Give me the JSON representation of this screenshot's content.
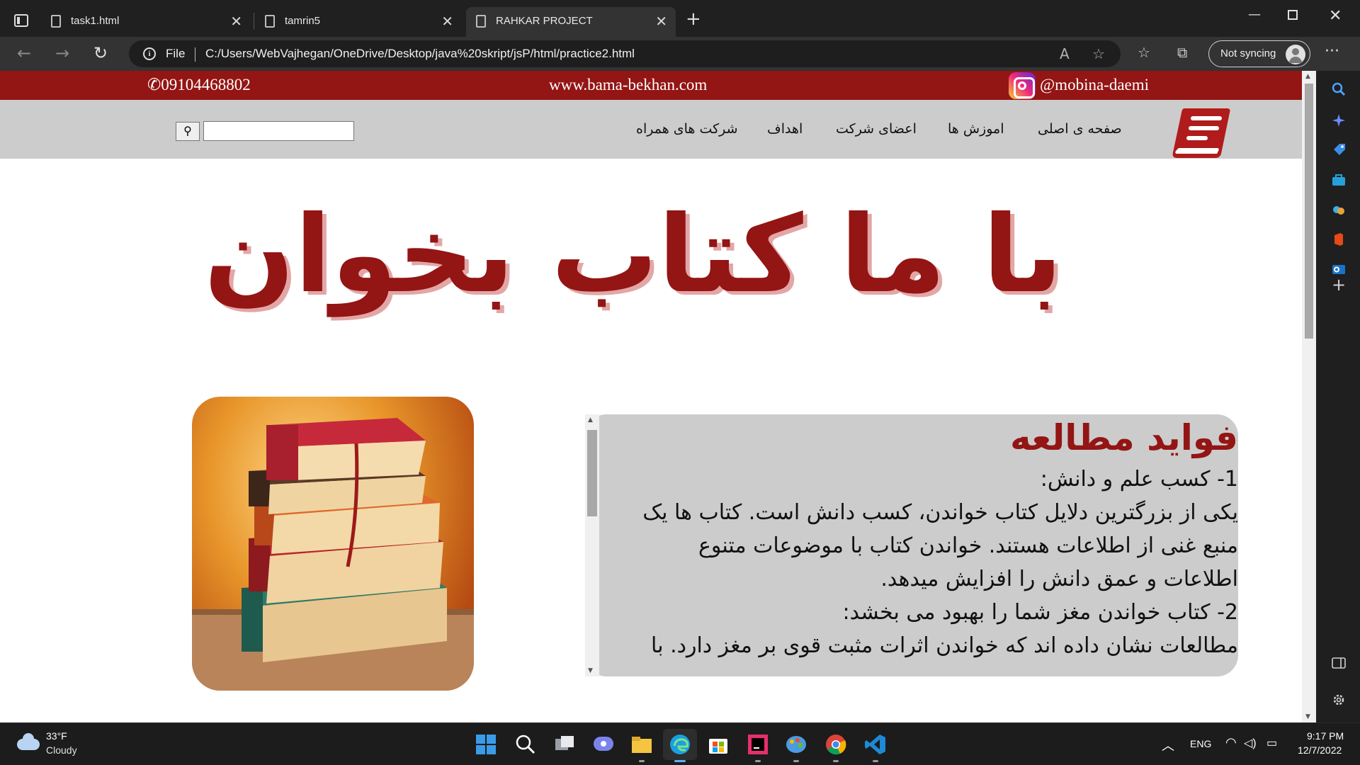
{
  "browser": {
    "tabs": [
      {
        "title": "task1.html"
      },
      {
        "title": "tamrin5"
      },
      {
        "title": "RAHKAR PROJECT"
      }
    ],
    "address": {
      "scheme": "File",
      "url": "C:/Users/WebVajhegan/OneDrive/Desktop/java%20skript/jsP/html/practice2.html"
    },
    "profile_label": "Not syncing"
  },
  "site": {
    "topbar": {
      "phone": "09104468802",
      "website": "www.bama-bekhan.com",
      "instagram": "@mobina-daemi"
    },
    "menu": [
      {
        "label": "صفحه ی اصلی"
      },
      {
        "label": "اموزش ها"
      },
      {
        "label": "اعضای شرکت"
      },
      {
        "label": "اهداف"
      },
      {
        "label": "شرکت های همراه"
      }
    ],
    "search": {
      "placeholder": ""
    },
    "hero_title": "با ما کتاب بخوان",
    "panel": {
      "title": "فواید مطالعه",
      "lines": [
        "1- کسب علم و دانش:",
        "یکی از بزرگترین دلایل کتاب خواندن، کسب دانش است. کتاب ها یک",
        "منبع غنی از اطلاعات هستند. خواندن کتاب با موضوعات متنوع",
        "اطلاعات و عمق دانش را افزایش میدهد.",
        "2- کتاب خواندن مغز شما را بهبود می بخشد:",
        "مطالعات نشان داده اند که خواندن اثرات مثبت قوی بر مغز دارد. با"
      ]
    }
  },
  "taskbar": {
    "weather": {
      "temp": "33°F",
      "desc": "Cloudy"
    },
    "lang": "ENG",
    "time": "9:17 PM",
    "date": "12/7/2022"
  },
  "colors": {
    "brand_red": "#931514",
    "menu_gray": "#cccccc",
    "hero_shadow": "#e3a6a6"
  }
}
